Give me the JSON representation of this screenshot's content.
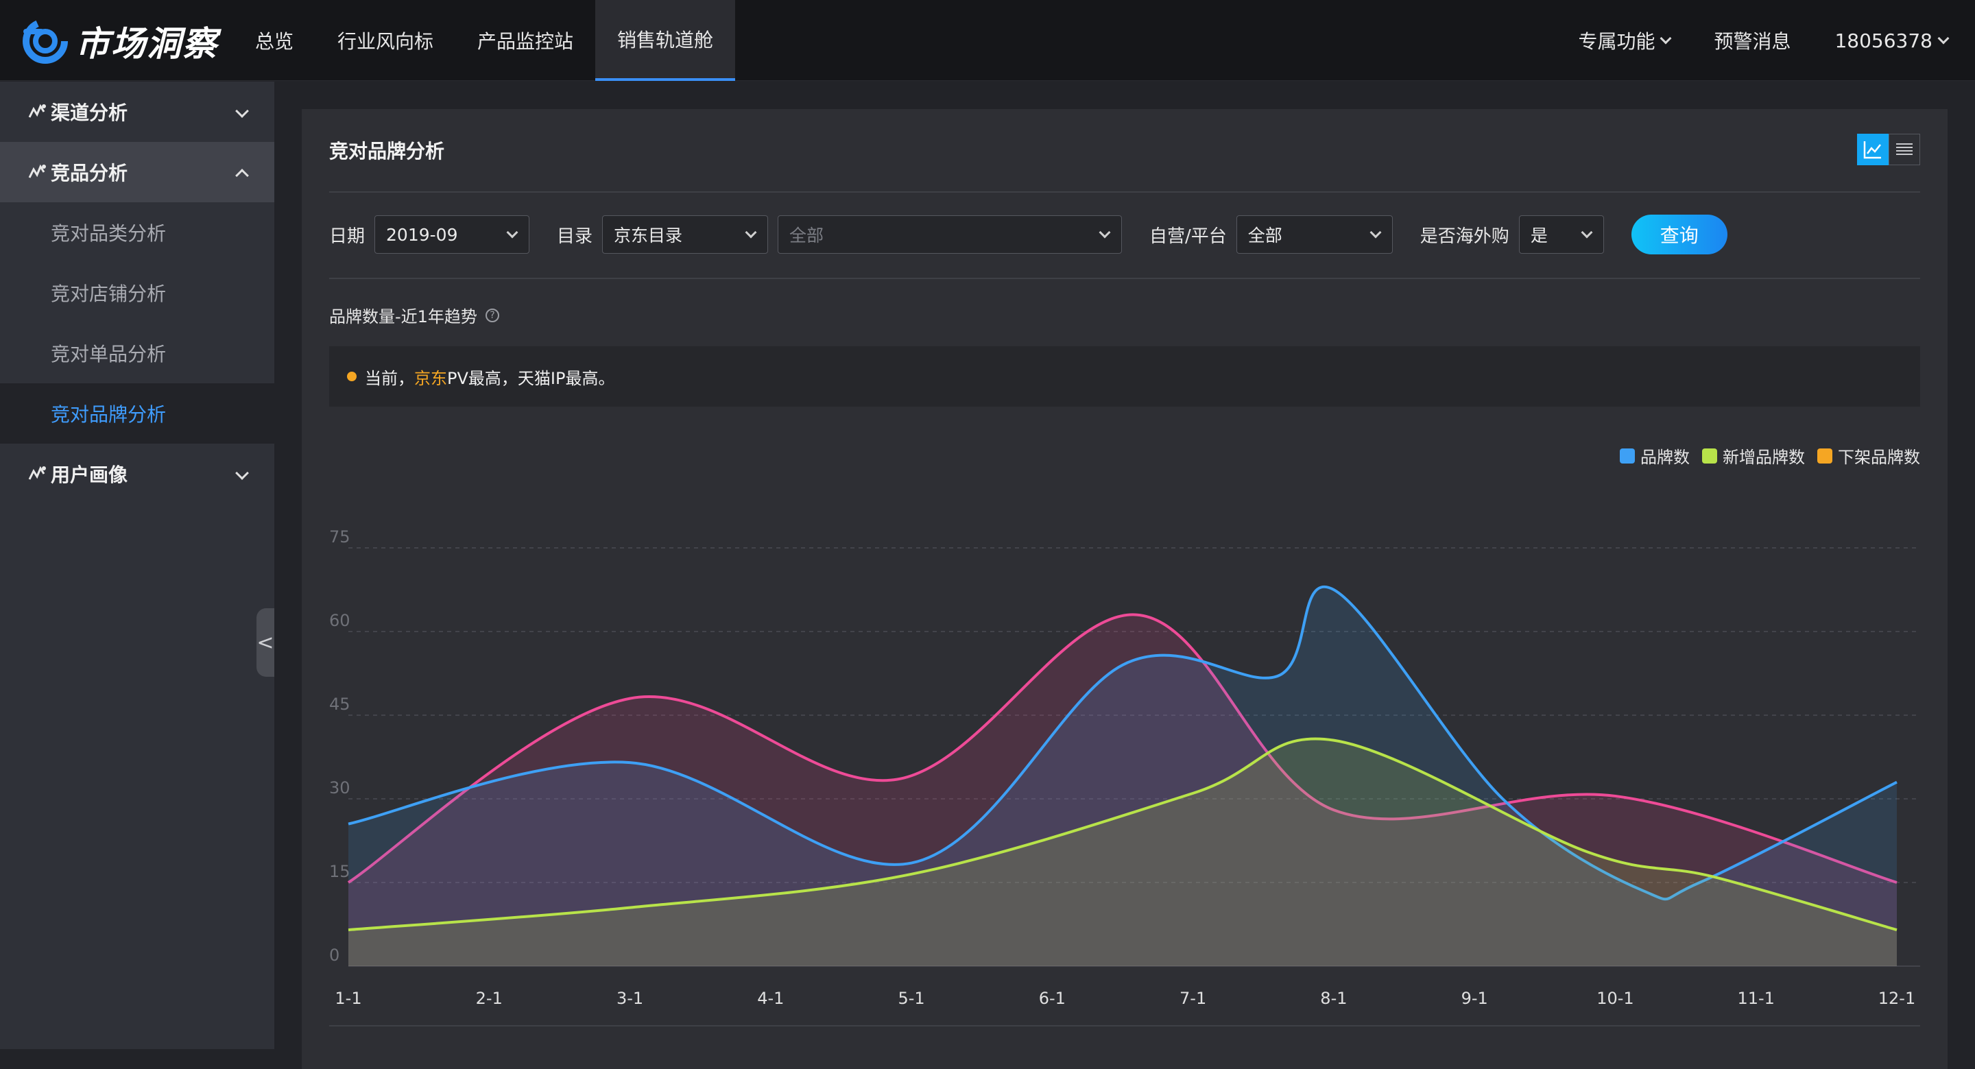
{
  "app": {
    "logo_text": "市场洞察"
  },
  "nav": {
    "items": [
      {
        "label": "总览"
      },
      {
        "label": "行业风向标"
      },
      {
        "label": "产品监控站"
      },
      {
        "label": "销售轨道舱",
        "active": true
      }
    ],
    "right": {
      "special": "专属功能",
      "alerts": "预警消息",
      "user": "18056378"
    }
  },
  "sidebar": {
    "groups": [
      {
        "label": "渠道分析",
        "open": false,
        "items": []
      },
      {
        "label": "竞品分析",
        "open": true,
        "items": [
          {
            "label": "竞对品类分析"
          },
          {
            "label": "竞对店铺分析"
          },
          {
            "label": "竞对单品分析"
          },
          {
            "label": "竞对品牌分析",
            "active": true
          }
        ]
      },
      {
        "label": "用户画像",
        "open": false,
        "items": []
      }
    ],
    "collapse_glyph": "<"
  },
  "panel": {
    "title": "竞对品牌分析"
  },
  "filters": {
    "date_label": "日期",
    "date_value": "2019-09",
    "catalog_label": "目录",
    "catalog_value": "京东目录",
    "catalog_sub_placeholder": "全部",
    "platform_label": "自营/平台",
    "platform_value": "全部",
    "overseas_label": "是否海外购",
    "overseas_value": "是",
    "query_label": "查询"
  },
  "chart_section": {
    "title": "品牌数量-近1年趋势",
    "help_glyph": "?",
    "notice_prefix": "当前，",
    "notice_highlight": "京东",
    "notice_suffix": "PV最高，天猫IP最高。"
  },
  "colors": {
    "accent": "#3f9dff",
    "series_brand": "#3ea0f5",
    "series_new": "#b8e34a",
    "series_removed": "#f5a623",
    "series_pink": "#ee4b97",
    "highlight": "#f5a623"
  },
  "chart_data": {
    "type": "area",
    "categories": [
      "1-1",
      "2-1",
      "3-1",
      "4-1",
      "5-1",
      "6-1",
      "7-1",
      "8-1",
      "9-1",
      "10-1",
      "11-1",
      "12-1"
    ],
    "ylim": [
      0,
      75
    ],
    "yticks": [
      0,
      15,
      30,
      45,
      60,
      75
    ],
    "grid": true,
    "legend_position": "top-right",
    "legend": [
      "品牌数",
      "新增品牌数",
      "下架品牌数"
    ],
    "series": [
      {
        "name": "品牌数",
        "color": "#3ea0f5",
        "x": [
          0,
          2,
          4,
          5.5,
          6.6,
          7,
          8.2,
          9.2,
          9.6,
          11
        ],
        "values": [
          25.5,
          36.5,
          18.5,
          54,
          52,
          67.5,
          30,
          13.5,
          15,
          33
        ]
      },
      {
        "name": "新增品牌数",
        "color": "#b8e34a",
        "x": [
          0,
          2,
          4,
          6,
          7,
          8.8,
          9.7,
          11
        ],
        "values": [
          6.5,
          10.5,
          16.5,
          31,
          40.5,
          20.5,
          16,
          6.5
        ]
      },
      {
        "name": "下架品牌数",
        "color": "#ee4b97",
        "x": [
          0,
          2,
          3.9,
          5.6,
          7,
          9,
          11
        ],
        "values": [
          15,
          48,
          33.5,
          63,
          28,
          30.5,
          15
        ]
      }
    ]
  }
}
